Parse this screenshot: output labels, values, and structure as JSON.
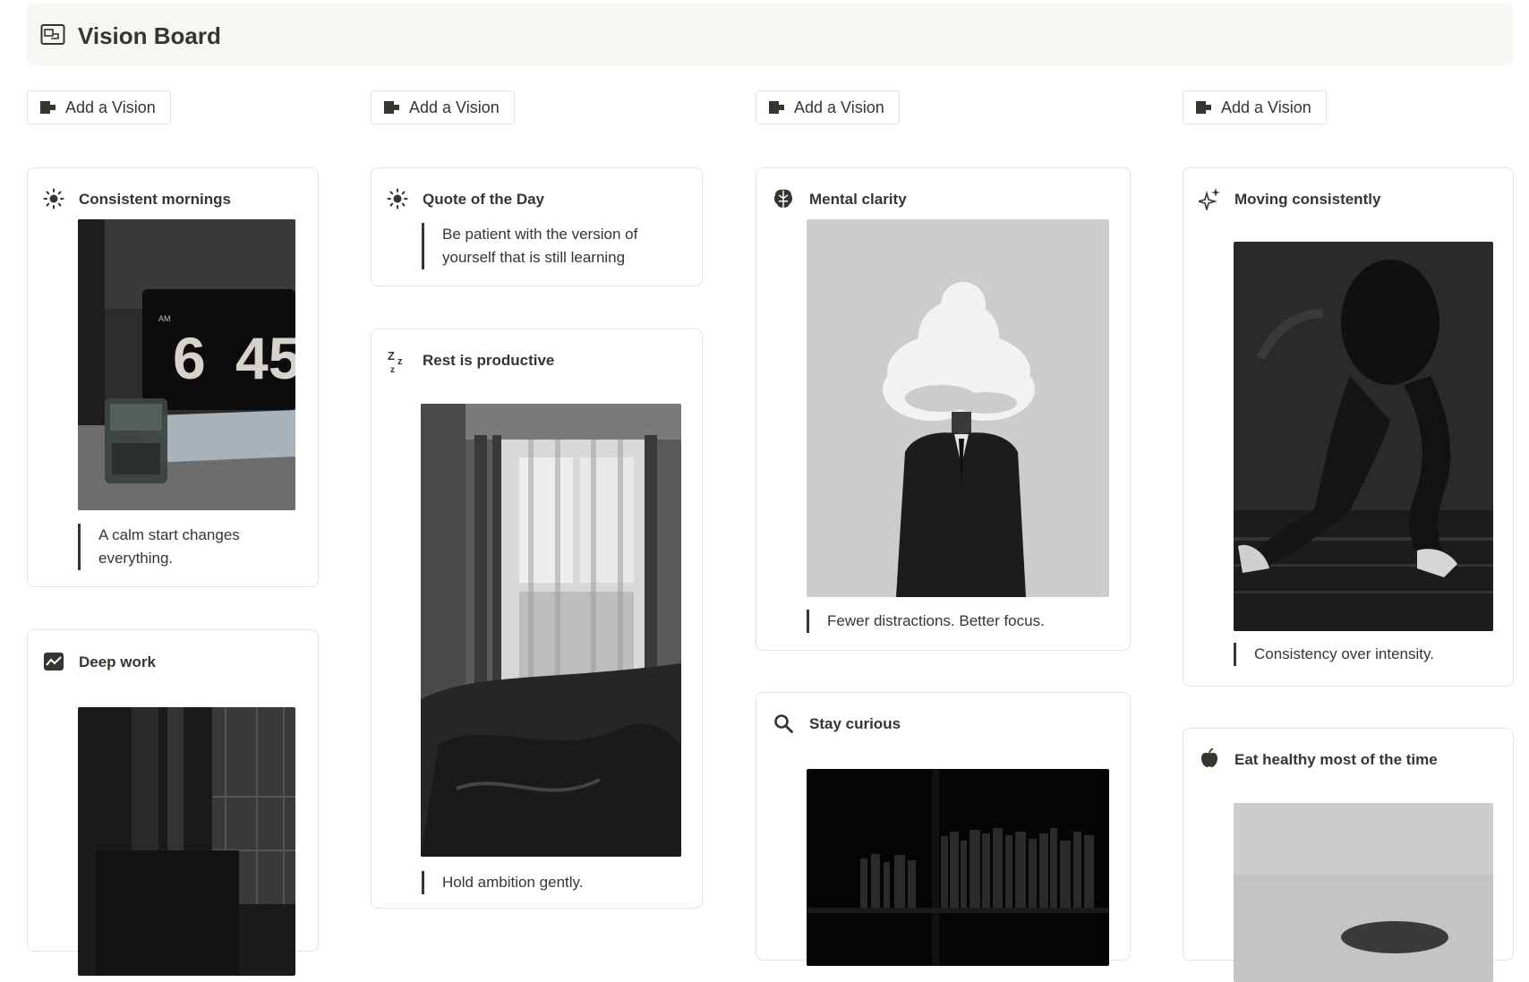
{
  "page": {
    "title": "Vision Board",
    "title_icon": "vision-board-icon"
  },
  "columns": [
    {
      "add_label": "Add a Vision",
      "cards": [
        {
          "title": "Consistent mornings",
          "icon": "sun-icon",
          "quote": "A calm start changes everything.",
          "image": "alarm-clock-photo"
        },
        {
          "title": "Deep work",
          "icon": "chart-icon",
          "image": "desk-window-photo"
        }
      ]
    },
    {
      "add_label": "Add a Vision",
      "cards": [
        {
          "title": "Quote of the Day",
          "icon": "sun-icon",
          "quote": "Be patient with the version of yourself that is still learning"
        },
        {
          "title": "Rest is productive",
          "icon": "zzz-icon",
          "quote": "Hold ambition gently.",
          "image": "bedroom-curtain-photo"
        }
      ]
    },
    {
      "add_label": "Add a Vision",
      "cards": [
        {
          "title": "Mental clarity",
          "icon": "brain-icon",
          "quote": "Fewer distractions. Better focus.",
          "image": "cloud-head-photo"
        },
        {
          "title": "Stay curious",
          "icon": "search-icon",
          "image": "bookshelf-photo"
        }
      ]
    },
    {
      "add_label": "Add a Vision",
      "cards": [
        {
          "title": "Moving consistently",
          "icon": "sparkles-icon",
          "quote": "Consistency over intensity.",
          "image": "runner-photo"
        },
        {
          "title": "Eat healthy most of the time",
          "icon": "apple-icon",
          "image": "food-photo"
        }
      ]
    }
  ],
  "photo_text": {
    "clock_am": "AM",
    "clock_hour": "6",
    "clock_minutes": "45"
  },
  "colors": {
    "text": "#37352f",
    "header_bg": "#f7f6f3",
    "border": "#e3e2e0"
  }
}
